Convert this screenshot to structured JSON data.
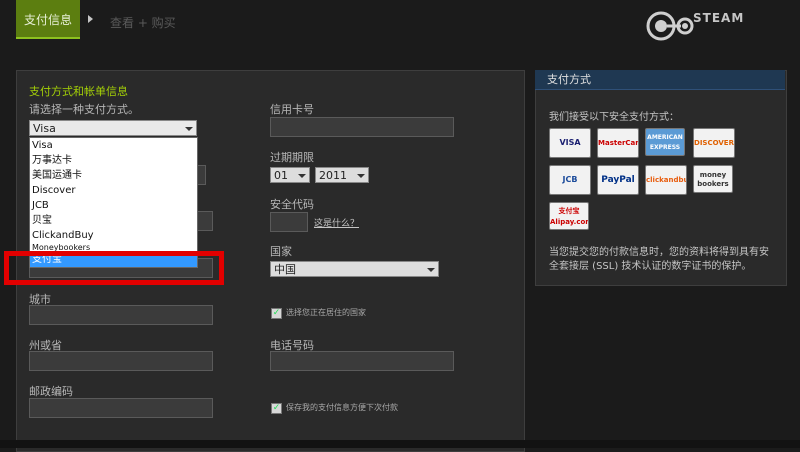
{
  "header": {
    "steps": [
      "支付信息",
      "查看 + 购买"
    ],
    "logo_text": "STEAM"
  },
  "form": {
    "section_title": "支付方式和帐单信息",
    "method_label": "请选择一种支付方式。",
    "method_selected": "Visa",
    "dropdown_options": [
      "Visa",
      "万事达卡",
      "美国运通卡",
      "Discover",
      "JCB",
      "贝宝",
      "ClickandBuy",
      "Moneybookers",
      "支付宝"
    ],
    "dropdown_selected": "支付宝",
    "card_number_label": "信用卡号",
    "expiry_label": "过期期限",
    "expiry_month": "01",
    "expiry_year": "2011",
    "security_code_label": "安全代码",
    "whats_this": "这是什么？",
    "country_label": "国家",
    "country_value": "中国",
    "city_label": "城市",
    "province_label": "州或省",
    "zip_label": "邮政编码",
    "phone_label": "电话号码",
    "checkbox1_label": "选择您正在居住的国家",
    "checkbox2_label": "保存我的支付信息方便下次付款"
  },
  "info": {
    "title": "支付方式",
    "accept_text": "我们接受以下安全支付方式：",
    "cards": [
      "VISA",
      "MasterCard",
      "AMERICAN EXPRESS",
      "DISCOVER",
      "JCB",
      "PayPal",
      "clickandbuy",
      "money bookers",
      "支付宝 Alipay.com"
    ],
    "security_text": "当您提交您的付款信息时，您的资料将得到具有安全套接层 (SSL) 技术认证的数字证书的保护。"
  },
  "colors": {
    "accent_green": "#8dc21f",
    "highlight_red": "#e20000",
    "select_blue": "#3399ff"
  }
}
